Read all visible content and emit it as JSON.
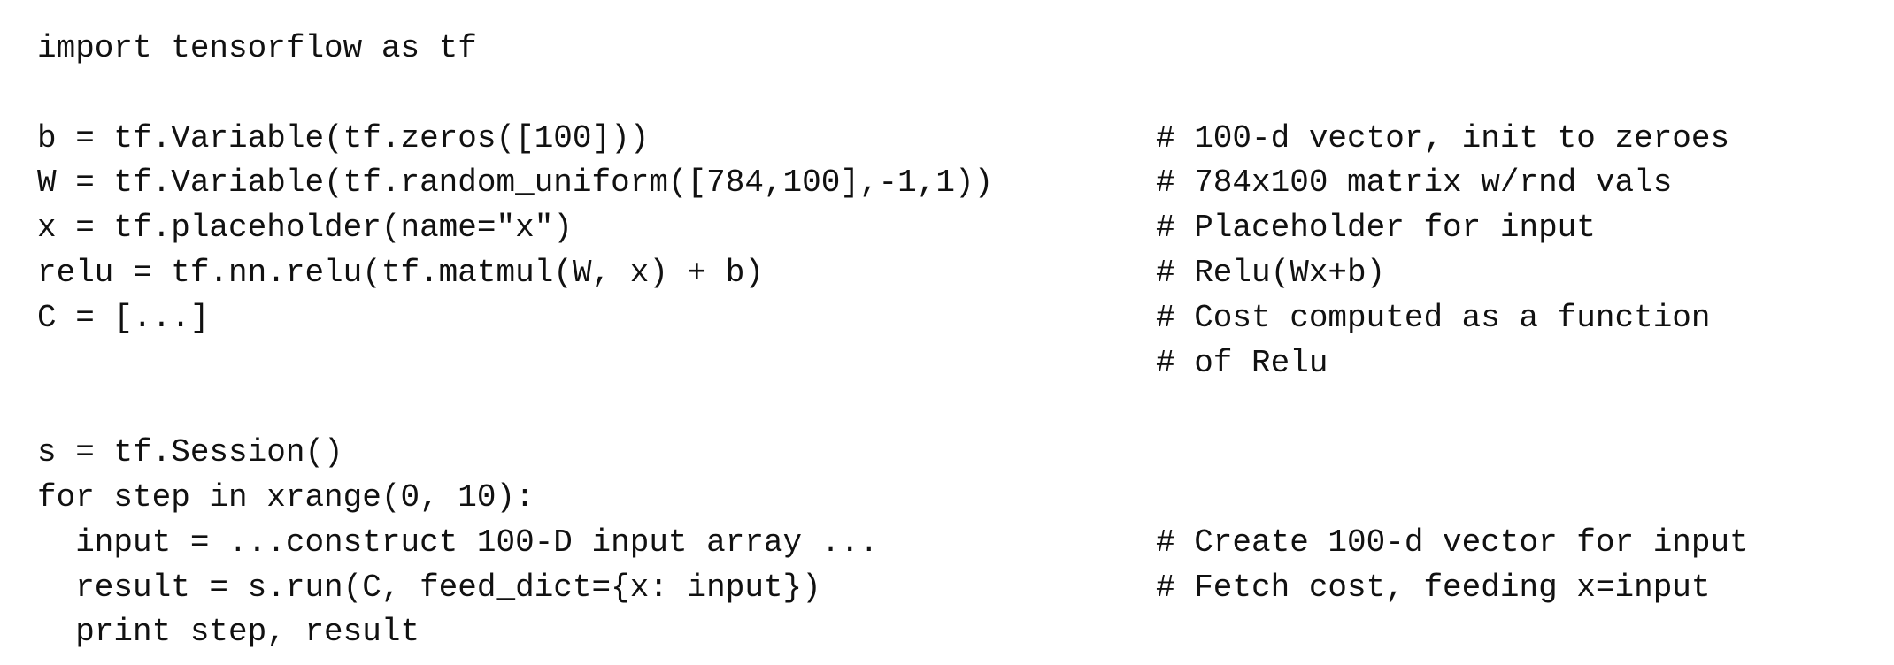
{
  "code_lines": [
    {
      "code": "import tensorflow as tf",
      "comment": ""
    },
    {
      "code": "",
      "comment": ""
    },
    {
      "code": "b = tf.Variable(tf.zeros([100]))",
      "comment": "# 100-d vector, init to zeroes"
    },
    {
      "code": "W = tf.Variable(tf.random_uniform([784,100],-1,1))",
      "comment": "# 784x100 matrix w/rnd vals"
    },
    {
      "code": "x = tf.placeholder(name=\"x\")",
      "comment": "# Placeholder for input"
    },
    {
      "code": "relu = tf.nn.relu(tf.matmul(W, x) + b)",
      "comment": "# Relu(Wx+b)"
    },
    {
      "code": "C = [...]",
      "comment": "# Cost computed as a function"
    },
    {
      "code": "",
      "comment": "# of Relu"
    },
    {
      "code": "",
      "comment": ""
    },
    {
      "code": "s = tf.Session()",
      "comment": ""
    },
    {
      "code": "for step in xrange(0, 10):",
      "comment": ""
    },
    {
      "code": "  input = ...construct 100-D input array ...",
      "comment": "# Create 100-d vector for input"
    },
    {
      "code": "  result = s.run(C, feed_dict={x: input})",
      "comment": "# Fetch cost, feeding x=input"
    },
    {
      "code": "  print step, result",
      "comment": ""
    }
  ]
}
